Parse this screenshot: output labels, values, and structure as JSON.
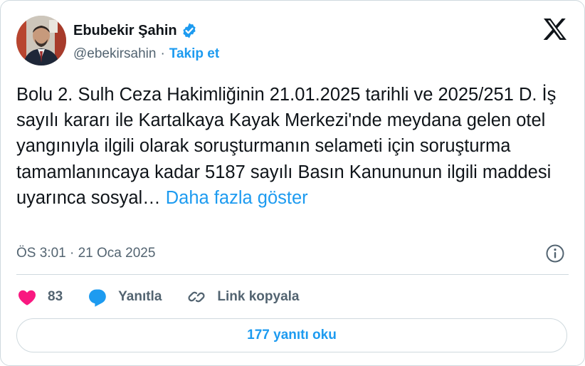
{
  "author": {
    "name": "Ebubekir Şahin",
    "handle": "@ebekirsahin",
    "separator": "·",
    "follow_label": "Takip et"
  },
  "tweet": {
    "text": "Bolu 2. Sulh Ceza Hakimliğinin 21.01.2025 tarihli ve 2025/251 D. İş sayılı kararı ile Kartalkaya Kayak Merkezi'nde meydana gelen otel yangınıyla ilgili olarak soruşturmanın selameti için soruşturma tamamlanıncaya kadar 5187 sayılı Basın Kanununun ilgili maddesi uyarınca sosyal…",
    "show_more_label": "Daha fazla göster",
    "timestamp": "ÖS 3:01 · 21 Oca 2025"
  },
  "actions": {
    "like_count": "83",
    "reply_label": "Yanıtla",
    "copy_link_label": "Link kopyala"
  },
  "replies_button": "177 yanıtı oku",
  "colors": {
    "accent": "#1d9bf0",
    "like": "#f91880",
    "text": "#0f1419",
    "secondary": "#536471",
    "border": "#cfd9de"
  },
  "icons": [
    "verified-badge-icon",
    "x-logo-icon",
    "info-icon",
    "heart-icon",
    "reply-bubble-icon",
    "link-icon"
  ]
}
